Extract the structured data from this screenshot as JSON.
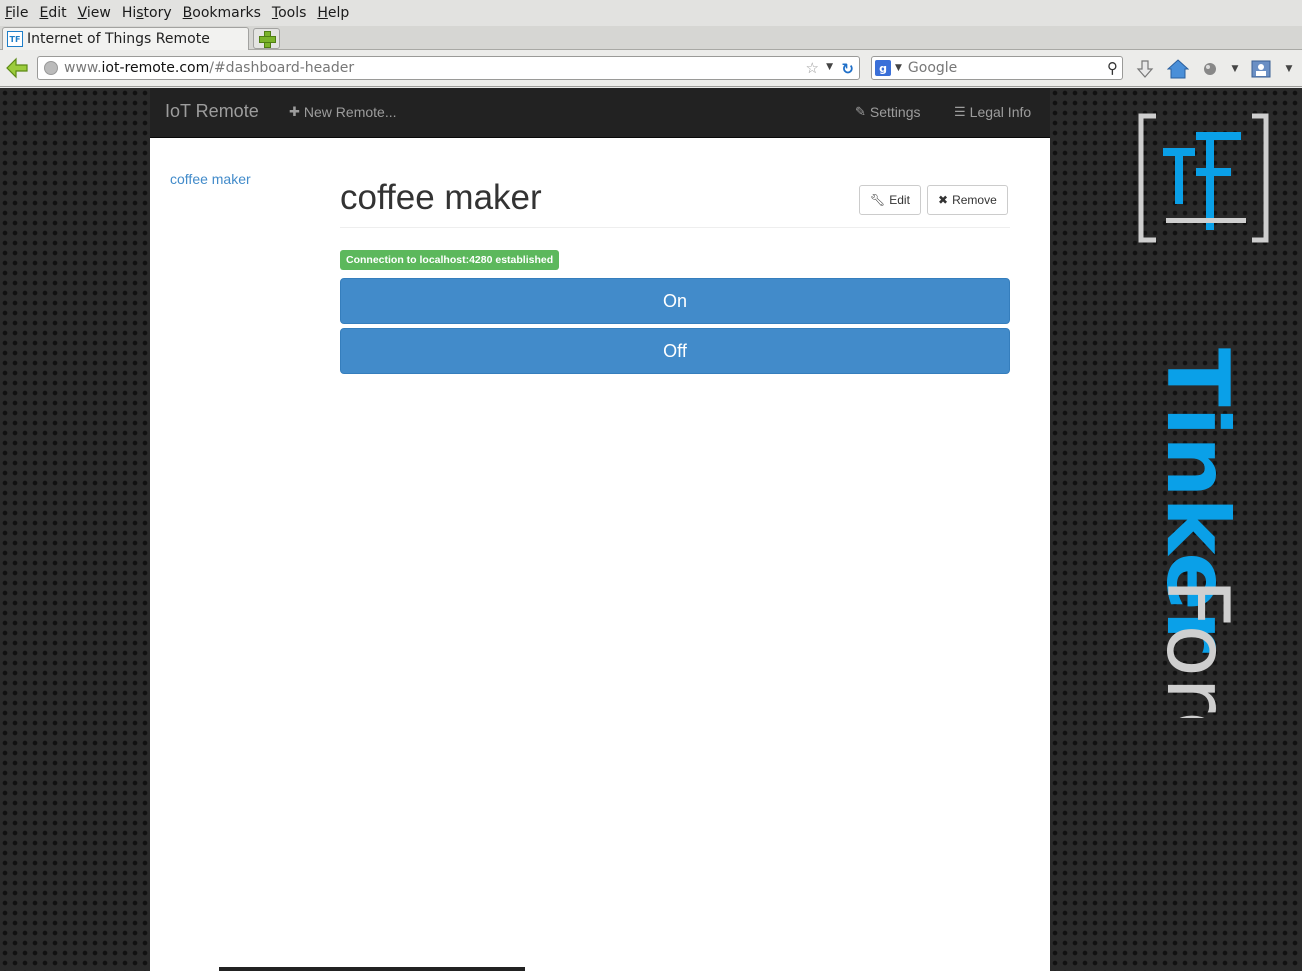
{
  "menubar": {
    "items": [
      {
        "label": "File",
        "accel": "F",
        "rest": "ile"
      },
      {
        "label": "Edit",
        "accel": "E",
        "rest": "dit"
      },
      {
        "label": "View",
        "accel": "V",
        "rest": "iew"
      },
      {
        "label": "History",
        "pre": "Hi",
        "accel": "s",
        "rest": "tory"
      },
      {
        "label": "Bookmarks",
        "accel": "B",
        "rest": "ookmarks"
      },
      {
        "label": "Tools",
        "accel": "T",
        "rest": "ools"
      },
      {
        "label": "Help",
        "accel": "H",
        "rest": "elp"
      }
    ]
  },
  "tabs": [
    {
      "title": "Internet of Things Remote",
      "favicon": "TF"
    }
  ],
  "address": {
    "prefix": "www.",
    "domain": "iot-remote.com",
    "path": "/#dashboard-header"
  },
  "search": {
    "placeholder": "Google",
    "engine_icon": "g"
  },
  "app": {
    "brand": "IoT Remote",
    "new_remote": "New Remote...",
    "settings": "Settings",
    "legal": "Legal Info"
  },
  "sidebar": {
    "items": [
      {
        "label": "coffee maker"
      }
    ]
  },
  "remote": {
    "title": "coffee maker",
    "edit_label": "Edit",
    "remove_label": "Remove",
    "status": "Connection to localhost:4280 established",
    "buttons": [
      {
        "label": "On"
      },
      {
        "label": "Off"
      }
    ]
  },
  "colors": {
    "primary": "#428bca",
    "success": "#5cb85c",
    "navbar": "#222222",
    "brand_blue": "#0aa0e8",
    "brand_grey": "#cccccc"
  }
}
